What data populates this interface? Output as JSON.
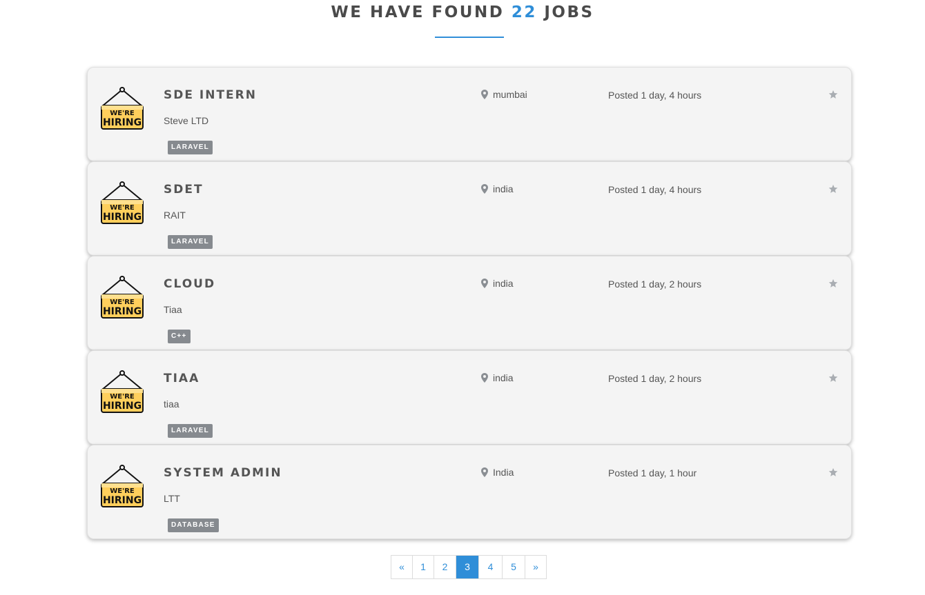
{
  "heading": {
    "prefix": "WE HAVE FOUND",
    "count": "22",
    "suffix": "JOBS"
  },
  "jobs": [
    {
      "title": "SDE INTERN",
      "company": "Steve LTD",
      "location": "mumbai",
      "posted": "Posted 1 day, 4 hours",
      "tag": "LARAVEL"
    },
    {
      "title": "SDET",
      "company": "RAIT",
      "location": "india",
      "posted": "Posted 1 day, 4 hours",
      "tag": "LARAVEL"
    },
    {
      "title": "CLOUD",
      "company": "Tiaa",
      "location": "india",
      "posted": "Posted 1 day, 2 hours",
      "tag": "C++"
    },
    {
      "title": "TIAA",
      "company": "tiaa",
      "location": "india",
      "posted": "Posted 1 day, 2 hours",
      "tag": "LARAVEL"
    },
    {
      "title": "SYSTEM ADMIN",
      "company": "LTT",
      "location": "India",
      "posted": "Posted 1 day, 1 hour",
      "tag": "DATABASE"
    }
  ],
  "logo": {
    "line1": "WE'RE",
    "line2": "HIRING"
  },
  "pagination": {
    "prev": "«",
    "pages": [
      "1",
      "2",
      "3",
      "4",
      "5"
    ],
    "next": "»",
    "current": "3"
  },
  "icons": {
    "location": "map-marker-icon",
    "favorite": "star-icon",
    "logo": "hiring-sign-icon"
  },
  "colors": {
    "accent": "#2f8ed8",
    "tag_bg": "#868a8f",
    "card_bg": "#f4f4f4",
    "star": "#a9adb2"
  }
}
